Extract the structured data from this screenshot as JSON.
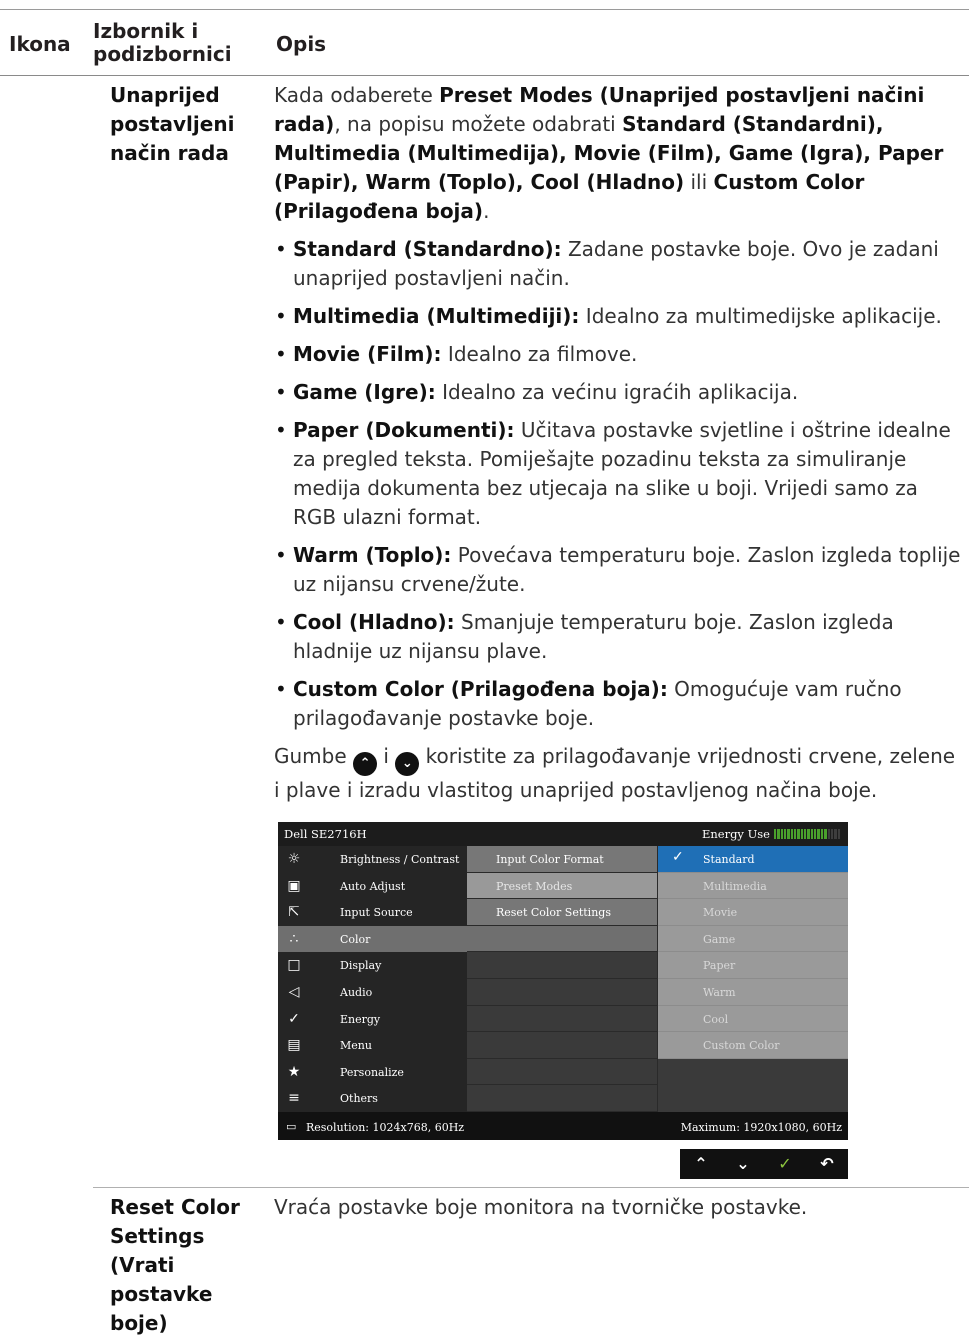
{
  "header": {
    "col1": "Ikona",
    "col2": "Izbornik i podizbornici",
    "col3": "Opis"
  },
  "row1": {
    "submenu": "Unaprijed postavljeni način rada",
    "intro": {
      "t1": "Kada odaberete ",
      "b1": "Preset Modes (Unaprijed postavljeni načini rada)",
      "t2": ", na popisu možete odabrati ",
      "b2": "Standard (Standardni), Multimedia (Multimedija), Movie (Film), Game (Igra), Paper (Papir), Warm (Toplo), Cool (Hladno)",
      "t3": " ili ",
      "b3": "Custom Color (Prilagođena boja)",
      "t4": "."
    },
    "bullets": [
      {
        "term": "Standard (Standardno):",
        "text": " Zadane postavke boje. Ovo je zadani unaprijed postavljeni način."
      },
      {
        "term": "Multimedia (Multimediji):",
        "text": " Idealno za multimedijske aplikacije."
      },
      {
        "term": "Movie (Film):",
        "text": " Idealno za filmove."
      },
      {
        "term": "Game (Igre):",
        "text": " Idealno za većinu igraćih aplikacija."
      },
      {
        "term": "Paper (Dokumenti):",
        "text": " Učitava postavke svjetline i oštrine idealne za pregled teksta. Pomiješajte pozadinu teksta za simuliranje medija dokumenta bez utjecaja na slike u boji. Vrijedi samo za RGB ulazni format."
      },
      {
        "term": "Warm (Toplo):",
        "text": " Povećava temperaturu boje. Zaslon izgleda toplije uz nijansu crvene/žute."
      },
      {
        "term": "Cool (Hladno):",
        "text": " Smanjuje temperaturu boje. Zaslon izgleda hladnije uz nijansu plave."
      },
      {
        "term": "Custom Color (Prilagođena boja):",
        "text": " Omogućuje vam ručno prilagođavanje postavke boje."
      }
    ],
    "closing": {
      "t1": "Gumbe ",
      "t2": " i ",
      "t3": " koristite za prilagođavanje vrijednosti crvene, zelene i plave i izradu vlastitog unaprijed postavljenog načina boje."
    }
  },
  "osd": {
    "model": "Dell SE2716H",
    "energy_label": "Energy Use",
    "energy_level": 0.8,
    "menu": [
      {
        "icon": "brightness-icon",
        "label": "Brightness / Contrast"
      },
      {
        "icon": "auto-adjust-icon",
        "label": "Auto Adjust"
      },
      {
        "icon": "input-source-icon",
        "label": "Input Source"
      },
      {
        "icon": "color-icon",
        "label": "Color"
      },
      {
        "icon": "display-icon",
        "label": "Display"
      },
      {
        "icon": "audio-icon",
        "label": "Audio"
      },
      {
        "icon": "energy-icon",
        "label": "Energy"
      },
      {
        "icon": "menu-icon",
        "label": "Menu"
      },
      {
        "icon": "star-icon",
        "label": "Personalize"
      },
      {
        "icon": "others-icon",
        "label": "Others"
      }
    ],
    "submenu": [
      "Input Color Format",
      "Preset Modes",
      "Reset Color Settings"
    ],
    "options": [
      "Standard",
      "Multimedia",
      "Movie",
      "Game",
      "Paper",
      "Warm",
      "Cool",
      "Custom Color"
    ],
    "selected_option": "Standard",
    "resolution": "Resolution: 1024x768, 60Hz",
    "maximum": "Maximum: 1920x1080, 60Hz"
  },
  "row2": {
    "submenu": "Reset Color Settings (Vrati postavke boje)",
    "desc": "Vraća postavke boje monitora na tvorničke postavke."
  }
}
